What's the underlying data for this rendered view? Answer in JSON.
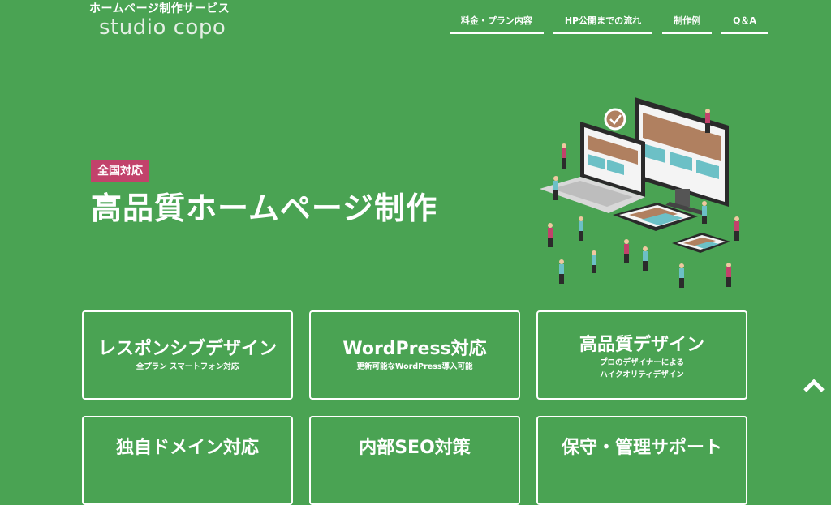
{
  "header": {
    "tagline": "ホームページ制作サービス",
    "brand": "studio copo",
    "nav": [
      {
        "label": "料金・プラン内容"
      },
      {
        "label": "HP公開までの流れ"
      },
      {
        "label": "制作例"
      },
      {
        "label": "Q＆A"
      }
    ]
  },
  "hero": {
    "badge": "全国対応",
    "title": "高品質ホームページ制作"
  },
  "features": [
    {
      "title": "レスポンシブデザイン",
      "sub": "全プラン スマートフォン対応"
    },
    {
      "title": "WordPress対応",
      "sub": "更新可能なWordPress導入可能"
    },
    {
      "title": "高品質デザイン",
      "sub": "プロのデザイナーによる\nハイクオリティデザイン"
    },
    {
      "title": "独自ドメイン対応",
      "sub": ""
    },
    {
      "title": "内部SEO対策",
      "sub": ""
    },
    {
      "title": "保守・管理サポート",
      "sub": ""
    }
  ],
  "colors": {
    "background": "#4aa353",
    "badge": "#c2426b",
    "text": "#ffffff"
  },
  "icons": {
    "scroll_top": "chevron-up-icon"
  }
}
